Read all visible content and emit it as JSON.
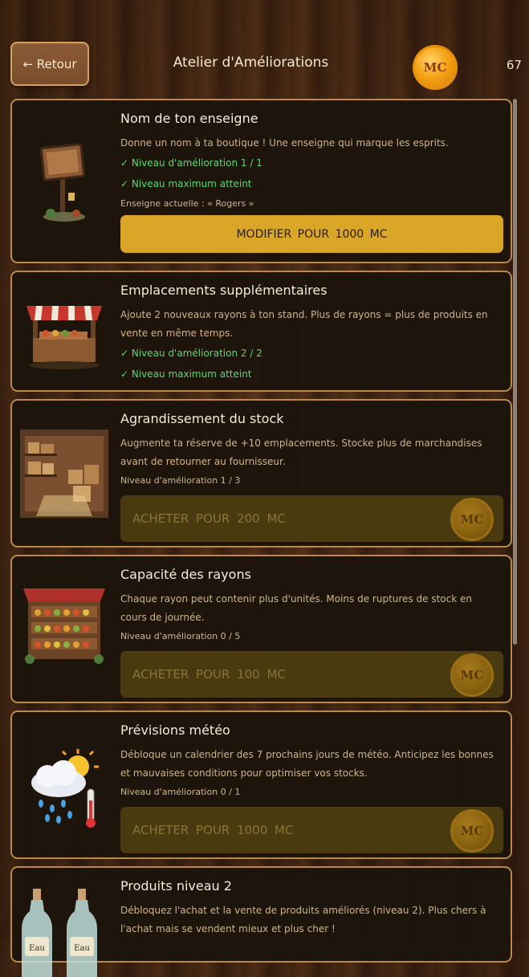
{
  "header": {
    "back_label": "← Retour",
    "title": "Atelier d'Améliorations",
    "coin_label": "MC",
    "coin_count": "67"
  },
  "upgrades": [
    {
      "title": "Nom de ton enseigne",
      "description": "Donne un nom à ta boutique ! Une enseigne qui marque les esprits.",
      "level": "✓ Niveau d'amélioration 1 / 1",
      "max": "✓ Niveau maximum atteint",
      "current_sign": "Enseigne actuelle : « Rogers »",
      "button_label": "MODIFIER POUR   1000 MC"
    },
    {
      "title": "Emplacements supplémentaires",
      "description": "Ajoute 2 nouveaux rayons à ton stand. Plus de rayons = plus de produits en vente en même temps.",
      "level": "✓ Niveau d'amélioration 2 / 2",
      "max": "✓ Niveau maximum atteint"
    },
    {
      "title": "Agrandissement du stock",
      "description": "Augmente ta réserve de +10 emplacements. Stocke plus de marchandises avant de retourner au fournisseur.",
      "level": "Niveau d'amélioration 1 / 3",
      "button_label": "ACHETER POUR   200 MC",
      "coin_label": "MC"
    },
    {
      "title": "Capacité des rayons",
      "description": "Chaque rayon peut contenir plus d'unités. Moins de ruptures de stock en cours de journée.",
      "level": "Niveau d'amélioration 0 / 5",
      "button_label": "ACHETER POUR   100 MC",
      "coin_label": "MC"
    },
    {
      "title": "Prévisions météo",
      "description": "Débloque un calendrier des 7 prochains jours de météo. Anticipez les bonnes et mauvaises conditions pour optimiser vos stocks.",
      "level": "Niveau d'amélioration 0 / 1",
      "button_label": "ACHETER POUR   1000 MC",
      "coin_label": "MC"
    },
    {
      "title": "Produits niveau 2",
      "description": "Débloquez l'achat et la vente de produits améliorés (niveau 2). Plus chers à l'achat mais se vendent mieux et plus cher !",
      "bottle_label": "Eau"
    }
  ]
}
